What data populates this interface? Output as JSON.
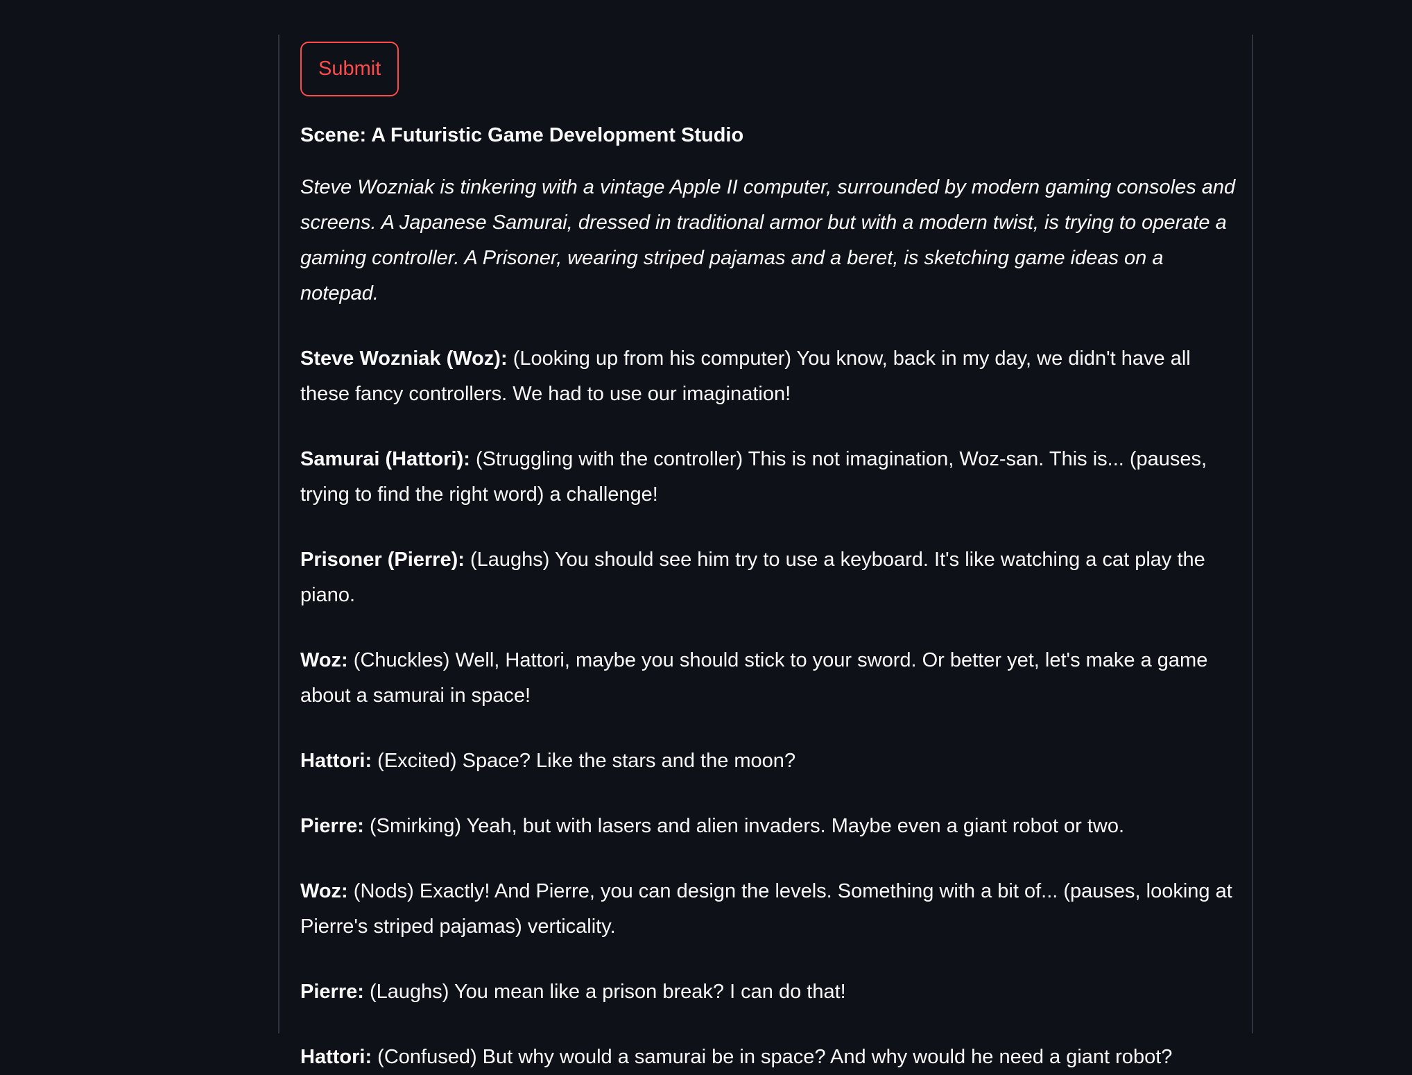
{
  "submit_label": "Submit",
  "scene_title": "Scene: A Futuristic Game Development Studio",
  "stage_direction": "Steve Wozniak is tinkering with a vintage Apple II computer, surrounded by modern gaming consoles and screens. A Japanese Samurai, dressed in traditional armor but with a modern twist, is trying to operate a gaming controller. A Prisoner, wearing striped pajamas and a beret, is sketching game ideas on a notepad.",
  "dialogue": [
    {
      "speaker": "Steve Wozniak (Woz):",
      "line": "(Looking up from his computer) You know, back in my day, we didn't have all these fancy controllers. We had to use our imagination!"
    },
    {
      "speaker": "Samurai (Hattori):",
      "line": "(Struggling with the controller) This is not imagination, Woz-san. This is... (pauses, trying to find the right word) a challenge!"
    },
    {
      "speaker": "Prisoner (Pierre):",
      "line": "(Laughs) You should see him try to use a keyboard. It's like watching a cat play the piano."
    },
    {
      "speaker": "Woz:",
      "line": "(Chuckles) Well, Hattori, maybe you should stick to your sword. Or better yet, let's make a game about a samurai in space!"
    },
    {
      "speaker": "Hattori:",
      "line": "(Excited) Space? Like the stars and the moon?"
    },
    {
      "speaker": "Pierre:",
      "line": "(Smirking) Yeah, but with lasers and alien invaders. Maybe even a giant robot or two."
    },
    {
      "speaker": "Woz:",
      "line": "(Nods) Exactly! And Pierre, you can design the levels. Something with a bit of... (pauses, looking at Pierre's striped pajamas) verticality."
    },
    {
      "speaker": "Pierre:",
      "line": "(Laughs) You mean like a prison break? I can do that!"
    },
    {
      "speaker": "Hattori:",
      "line": "(Confused) But why would a samurai be in space? And why would he need a giant robot?"
    }
  ]
}
